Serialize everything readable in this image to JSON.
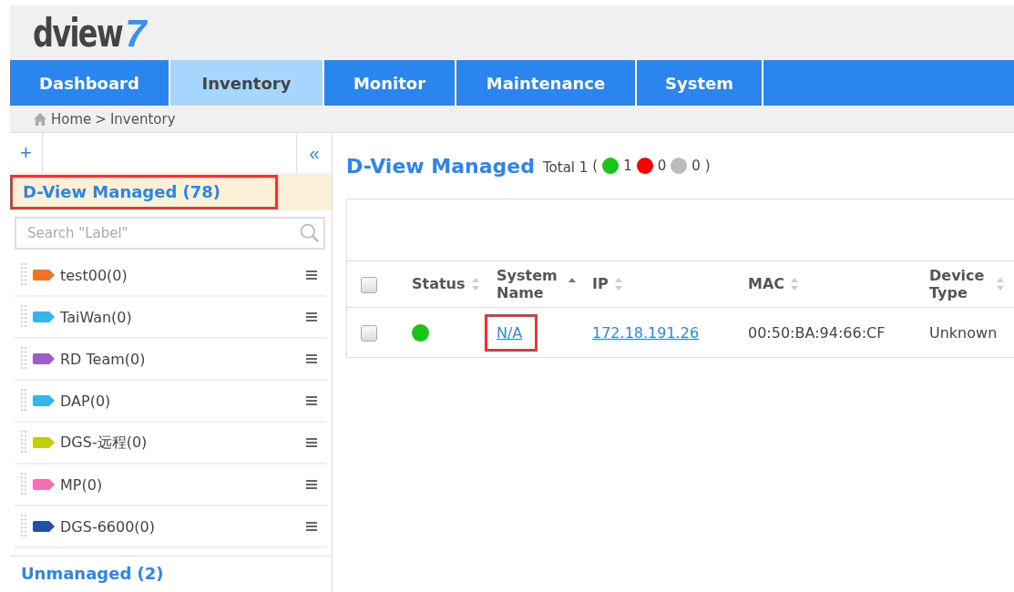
{
  "logo": {
    "text": "dview",
    "number": "7"
  },
  "nav": [
    {
      "label": "Dashboard",
      "selected": false
    },
    {
      "label": "Inventory",
      "selected": true
    },
    {
      "label": "Monitor",
      "selected": false
    },
    {
      "label": "Maintenance",
      "selected": false
    },
    {
      "label": "System",
      "selected": false
    }
  ],
  "breadcrumb": [
    "Home",
    ">",
    "Inventory"
  ],
  "sidebar": {
    "add": "+",
    "collapse": "«",
    "managed": {
      "label": "D-View Managed (78)",
      "selected": true,
      "highlighted": true
    },
    "search": {
      "placeholder": "Search \"Label\""
    },
    "labels": [
      {
        "name": "test00(0)",
        "color": "#ee7326"
      },
      {
        "name": "TaiWan(0)",
        "color": "#36b5ea"
      },
      {
        "name": "RD Team(0)",
        "color": "#9b5ccc"
      },
      {
        "name": "DAP(0)",
        "color": "#36b5ea"
      },
      {
        "name": "DGS-远程(0)",
        "color": "#c4cc10"
      },
      {
        "name": "MP(0)",
        "color": "#f56fb0"
      },
      {
        "name": "DGS-6600(0)",
        "color": "#20519e"
      }
    ],
    "unmanaged": {
      "label": "Unmanaged (2)"
    }
  },
  "main": {
    "title": "D-View Managed",
    "total": "Total 1",
    "open": "(",
    "close": ")",
    "counts": [
      {
        "value": "1",
        "color": "#18c418"
      },
      {
        "value": "0",
        "color": "#ff0000"
      },
      {
        "value": "0",
        "color": "#bbbbbb"
      }
    ],
    "table": {
      "select_all_checked": false,
      "columns": [
        {
          "label": "Status",
          "sorted": false
        },
        {
          "label": "System Name",
          "sorted": true
        },
        {
          "label": "IP",
          "sorted": false
        },
        {
          "label": "MAC",
          "sorted": false
        },
        {
          "label": "Device Type",
          "sorted": false
        }
      ],
      "rows": [
        {
          "checked": false,
          "color": "#18c418",
          "system_name": "N/A",
          "system_name_highlighted": true,
          "ip": "172.18.191.26",
          "mac": "00:50:BA:94:66:CF",
          "device_type": "Unknown"
        }
      ]
    }
  }
}
